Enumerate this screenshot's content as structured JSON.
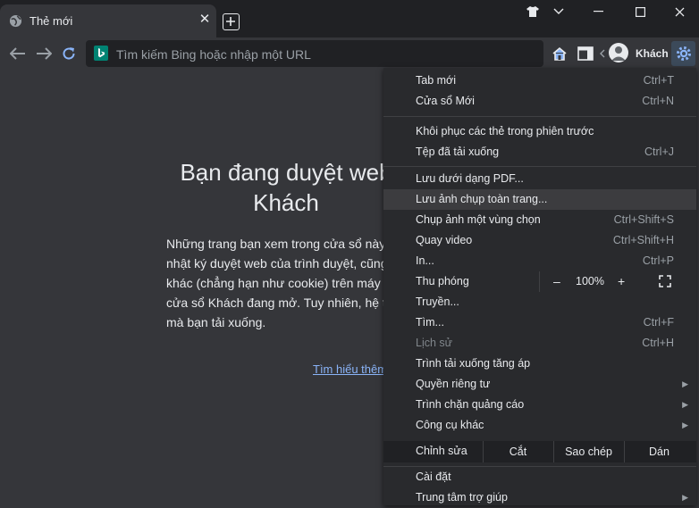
{
  "tab": {
    "title": "Thẻ mới",
    "close": "✕"
  },
  "omnibox": {
    "placeholder": "Tìm kiếm Bing hoặc nhập một URL"
  },
  "profile": {
    "name": "Khách"
  },
  "page": {
    "title_line1": "Bạn đang duyệt web",
    "title_line2": "Khách",
    "body_lines": [
      "Những trang bạn xem trong cửa sổ này s",
      "nhật ký duyệt web của trình duyệt, cũng",
      "khác (chẳng hạn như cookie) trên máy tí",
      "cửa sổ Khách đang mở. Tuy nhiên, hệ thố",
      "mà bạn tải xuống."
    ],
    "learn_more": "Tìm hiểu thêm"
  },
  "menu": {
    "items": [
      {
        "label": "Tab mới",
        "shortcut": "Ctrl+T"
      },
      {
        "label": "Cửa sổ Mới",
        "shortcut": "Ctrl+N"
      },
      {
        "label": "Khôi phục các thẻ trong phiên trước",
        "shortcut": ""
      },
      {
        "label": "Tệp đã tải xuống",
        "shortcut": "Ctrl+J"
      },
      {
        "label": "Lưu dưới dạng PDF...",
        "shortcut": ""
      },
      {
        "label": "Lưu ảnh chụp toàn trang...",
        "shortcut": ""
      },
      {
        "label": "Chụp ảnh một vùng chọn",
        "shortcut": "Ctrl+Shift+S"
      },
      {
        "label": "Quay video",
        "shortcut": "Ctrl+Shift+H"
      },
      {
        "label": "In...",
        "shortcut": "Ctrl+P"
      },
      {
        "label": "Truyền...",
        "shortcut": ""
      },
      {
        "label": "Tìm...",
        "shortcut": "Ctrl+F"
      },
      {
        "label": "Lịch sử",
        "shortcut": "Ctrl+H"
      },
      {
        "label": "Trình tải xuống tăng áp",
        "shortcut": ""
      },
      {
        "label": "Quyền riêng tư",
        "shortcut": ""
      },
      {
        "label": "Trình chặn quảng cáo",
        "shortcut": ""
      },
      {
        "label": "Công cụ khác",
        "shortcut": ""
      },
      {
        "label": "Cài đặt",
        "shortcut": ""
      },
      {
        "label": "Trung tâm trợ giúp",
        "shortcut": ""
      }
    ],
    "zoom": {
      "label": "Thu phóng",
      "minus": "–",
      "value": "100%",
      "plus": "+"
    },
    "edit": {
      "label": "Chỉnh sửa",
      "cut": "Cắt",
      "copy": "Sao chép",
      "paste": "Dán"
    },
    "submenu_arrow": "▶"
  },
  "colors": {
    "accent": "#8ab4f8",
    "bing": "#008373",
    "menu_bg": "#292a2d",
    "highlight": "#3c3c3f"
  }
}
